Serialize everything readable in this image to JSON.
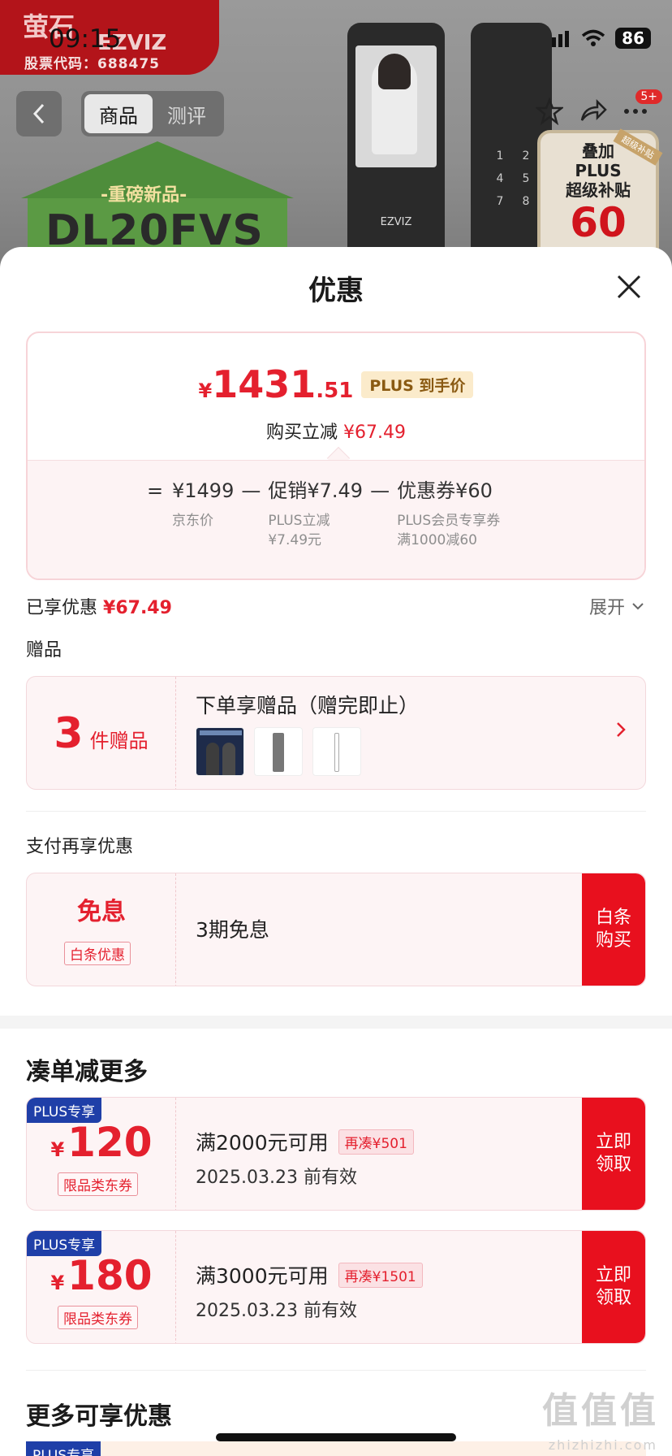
{
  "status_bar": {
    "time": "09:15",
    "battery": "86"
  },
  "background": {
    "brand_logo": "萤石",
    "brand_name": "EZVIZ",
    "stock_code": "股票代码：688475",
    "house_tag": "-重磅新品-",
    "house_model": "DL20FVS",
    "lock_brand": "EZVIZ",
    "keypad": [
      "1",
      "2",
      "4",
      "5",
      "7",
      "8",
      "",
      ""
    ],
    "plus_promo_title": "叠加\nPLUS\n超级补贴",
    "plus_promo_amount": "60",
    "plus_promo_ribbon": "超级补贴",
    "message_badge": "5+"
  },
  "nav": {
    "tabs": [
      "商品",
      "测评"
    ],
    "active_tab": "商品"
  },
  "sheet": {
    "title": "优惠",
    "price": {
      "yen": "¥",
      "integer": "1431",
      "decimal": ".51",
      "plus_label": "PLUS 到手价",
      "save_text": "购买立减",
      "save_amount": "¥67.49"
    },
    "formula": {
      "eq": "=",
      "items": [
        {
          "value": "¥1499",
          "note": "京东价"
        },
        {
          "value": "促销¥7.49",
          "note": "PLUS立减\n¥7.49元"
        },
        {
          "value": "优惠券¥60",
          "note": "PLUS会员专享券\n满1000减60"
        }
      ],
      "minus": "—"
    },
    "enjoyed_label": "已享优惠",
    "enjoyed_amount": "¥67.49",
    "expand_label": "展开",
    "gift_section": "赠品",
    "gift": {
      "count": "3",
      "unit": "件赠品",
      "desc": "下单享赠品（赠完即止）"
    },
    "pay_section": "支付再享优惠",
    "pay": {
      "big": "免息",
      "tag": "白条优惠",
      "desc": "3期免息",
      "button": "白条\n购买"
    },
    "bundle_title": "凑单减更多",
    "coupons": [
      {
        "plus": "PLUS专享",
        "yen": "¥",
        "amount": "120",
        "type": "限品类东券",
        "cond": "满2000元可用",
        "tag": "再凑¥501",
        "date": "2025.03.23 前有效",
        "button": "立即\n领取"
      },
      {
        "plus": "PLUS专享",
        "yen": "¥",
        "amount": "180",
        "type": "限品类东券",
        "cond": "满3000元可用",
        "tag": "再凑¥1501",
        "date": "2025.03.23 前有效",
        "button": "立即\n领取"
      }
    ],
    "more_title": "更多可享优惠",
    "more_peek_plus": "PLUS专享"
  },
  "watermark": {
    "text": "值值值",
    "url": "zhizhizhi.com"
  },
  "colors": {
    "accent_red": "#e4202e",
    "button_red": "#e8101e",
    "plus_blue": "#1f3fa8",
    "card_pink": "#fdf4f5"
  }
}
